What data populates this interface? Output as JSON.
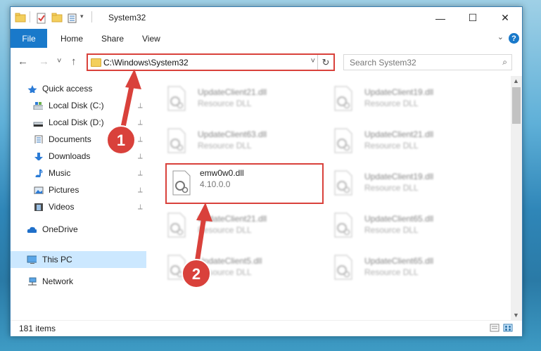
{
  "window": {
    "title": "System32",
    "controls": {
      "minimize": "—",
      "maximize": "☐",
      "close": "✕"
    }
  },
  "ribbon": {
    "tabs": [
      {
        "label": "File"
      },
      {
        "label": "Home"
      },
      {
        "label": "Share"
      },
      {
        "label": "View"
      }
    ],
    "help": "?"
  },
  "nav": {
    "back": "←",
    "forward": "→",
    "recent": "˅",
    "up": "↑",
    "address": "C:\\Windows\\System32",
    "dropdown": "˅",
    "refresh": "↻",
    "search_placeholder": "Search System32",
    "search_icon": "⌕"
  },
  "sidebar": {
    "items": [
      {
        "label": "Quick access",
        "icon": "star-icon",
        "pinned": false
      },
      {
        "label": "Local Disk (C:)",
        "icon": "drive-icon",
        "pinned": true
      },
      {
        "label": "Local Disk (D:)",
        "icon": "drive-icon",
        "pinned": true
      },
      {
        "label": "Documents",
        "icon": "documents-icon",
        "pinned": true
      },
      {
        "label": "Downloads",
        "icon": "download-arrow-icon",
        "pinned": true
      },
      {
        "label": "Music",
        "icon": "music-note-icon",
        "pinned": true
      },
      {
        "label": "Pictures",
        "icon": "pictures-icon",
        "pinned": true
      },
      {
        "label": "Videos",
        "icon": "film-icon",
        "pinned": true
      },
      {
        "label": "OneDrive",
        "icon": "cloud-icon",
        "pinned": false
      },
      {
        "label": "This PC",
        "icon": "monitor-icon",
        "pinned": false,
        "selected": true
      },
      {
        "label": "Network",
        "icon": "network-icon",
        "pinned": false
      }
    ],
    "pin_glyph": "📌"
  },
  "files": [
    {
      "name": "UpdateClient21.dll",
      "type": "Resource DLL"
    },
    {
      "name": "UpdateClient19.dll",
      "type": "Resource DLL"
    },
    {
      "name": "UpdateClient63.dll",
      "type": "Resource DLL"
    },
    {
      "name": "UpdateClient21.dll",
      "type": "Resource DLL"
    },
    {
      "name": "emw0w0.dll",
      "type": "4.10.0.0",
      "highlighted": true
    },
    {
      "name": "UpdateClient19.dll",
      "type": "Resource DLL"
    },
    {
      "name": "UpdateClient21.dll",
      "type": "Resource DLL"
    },
    {
      "name": "UpdateClient65.dll",
      "type": "Resource DLL"
    },
    {
      "name": "UpdateClient5.dll",
      "type": "Resource DLL"
    },
    {
      "name": "UpdateClient65.dll",
      "type": "Resource DLL"
    }
  ],
  "status": {
    "item_count": "181 items"
  },
  "annotations": [
    {
      "number": "1",
      "color": "#d9413b"
    },
    {
      "number": "2",
      "color": "#d9413b"
    }
  ]
}
